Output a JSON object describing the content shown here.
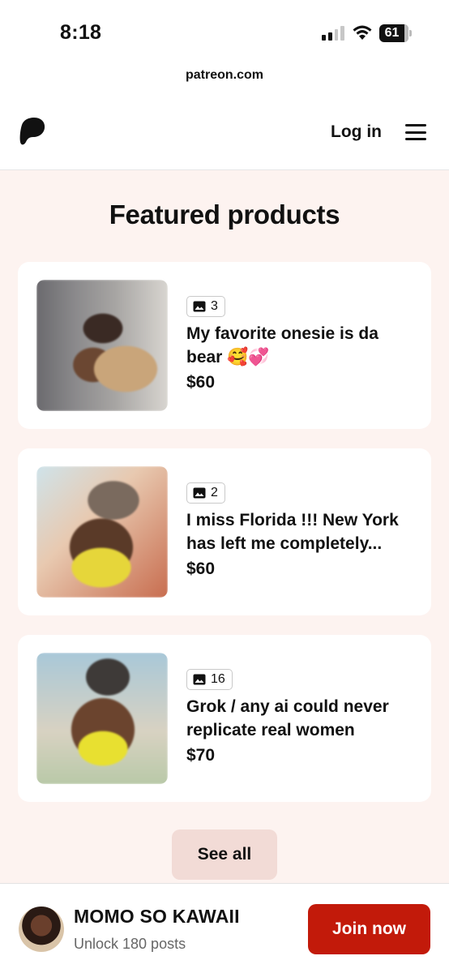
{
  "status_bar": {
    "time": "8:18",
    "battery": "61",
    "icons": [
      "cellular-signal-icon",
      "wifi-icon",
      "battery-icon"
    ]
  },
  "browser": {
    "url": "patreon.com"
  },
  "header": {
    "logo_icon": "patreon-logo-icon",
    "login_label": "Log in",
    "menu_icon": "hamburger-menu-icon"
  },
  "featured": {
    "title": "Featured products",
    "products": [
      {
        "image_count": "3",
        "title": "My favorite onesie is da bear 🥰💞",
        "price": "$60"
      },
      {
        "image_count": "2",
        "title": "I miss Florida !!! New York has left me completely...",
        "price": "$60"
      },
      {
        "image_count": "16",
        "title": "Grok / any ai could never replicate real women",
        "price": "$70"
      }
    ],
    "see_all_label": "See all"
  },
  "footer": {
    "creator_name": "MOMO SO KAWAII",
    "subtitle": "Unlock 180 posts",
    "join_label": "Join now"
  },
  "colors": {
    "page_background": "#fdf3f0",
    "join_button": "#c21a0a",
    "see_all_button": "#f2dbd6"
  }
}
